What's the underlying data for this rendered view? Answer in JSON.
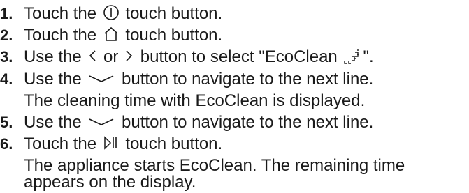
{
  "steps": [
    {
      "number": "1.",
      "before": "Touch the ",
      "icon": "power-icon",
      "after": " touch button.",
      "continuation": []
    },
    {
      "number": "2.",
      "before": "Touch the ",
      "icon": "home-icon",
      "after": " touch button.",
      "continuation": []
    },
    {
      "number": "3.",
      "before": "Use the ",
      "icon": "chevron-left-icon",
      "middle": " or ",
      "icon2": "chevron-right-icon",
      "after": " button to select \"EcoClean ",
      "icon3": "eco-clean-icon",
      "after2": "\".",
      "continuation": []
    },
    {
      "number": "4.",
      "before": "Use the ",
      "icon": "chevron-down-icon",
      "after": " button to navigate to the next line.",
      "continuation": [
        "The cleaning time with EcoClean is displayed."
      ]
    },
    {
      "number": "5.",
      "before": "Use the ",
      "icon": "chevron-down-icon",
      "after": " button to navigate to the next line.",
      "continuation": []
    },
    {
      "number": "6.",
      "before": "Touch the ",
      "icon": "play-pause-icon",
      "after": " touch button.",
      "continuation": [
        "The appliance starts EcoClean. The remaining time",
        "appears on the display."
      ]
    }
  ]
}
